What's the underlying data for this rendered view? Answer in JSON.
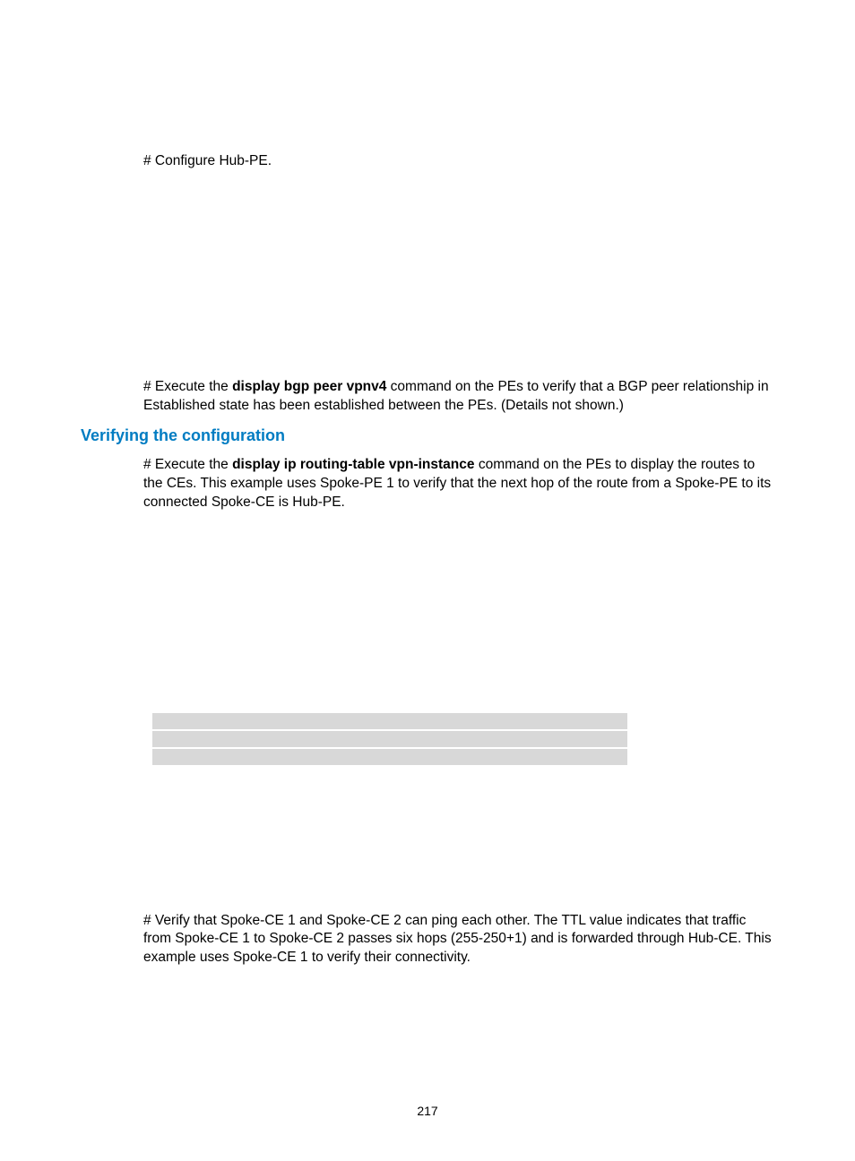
{
  "para1": "# Configure Hub-PE.",
  "para2_prefix": "# Execute the ",
  "para2_bold": "display bgp peer vpnv4",
  "para2_suffix": " command on the PEs to verify that a BGP peer relationship in Established state has been established between the PEs. (Details not shown.)",
  "heading": "Verifying the configuration",
  "para3_prefix": "# Execute the ",
  "para3_bold": "display ip routing-table vpn-instance",
  "para3_suffix": " command on the PEs to display the routes to the CEs. This example uses Spoke-PE 1 to verify that the next hop of the route from a Spoke-PE to its connected Spoke-CE is Hub-PE.",
  "para4": "# Verify that Spoke-CE 1 and Spoke-CE 2 can ping each other. The TTL value indicates that traffic from Spoke-CE 1 to Spoke-CE 2 passes six hops (255-250+1) and is forwarded through Hub-CE. This example uses Spoke-CE 1 to verify their connectivity.",
  "page_number": "217"
}
